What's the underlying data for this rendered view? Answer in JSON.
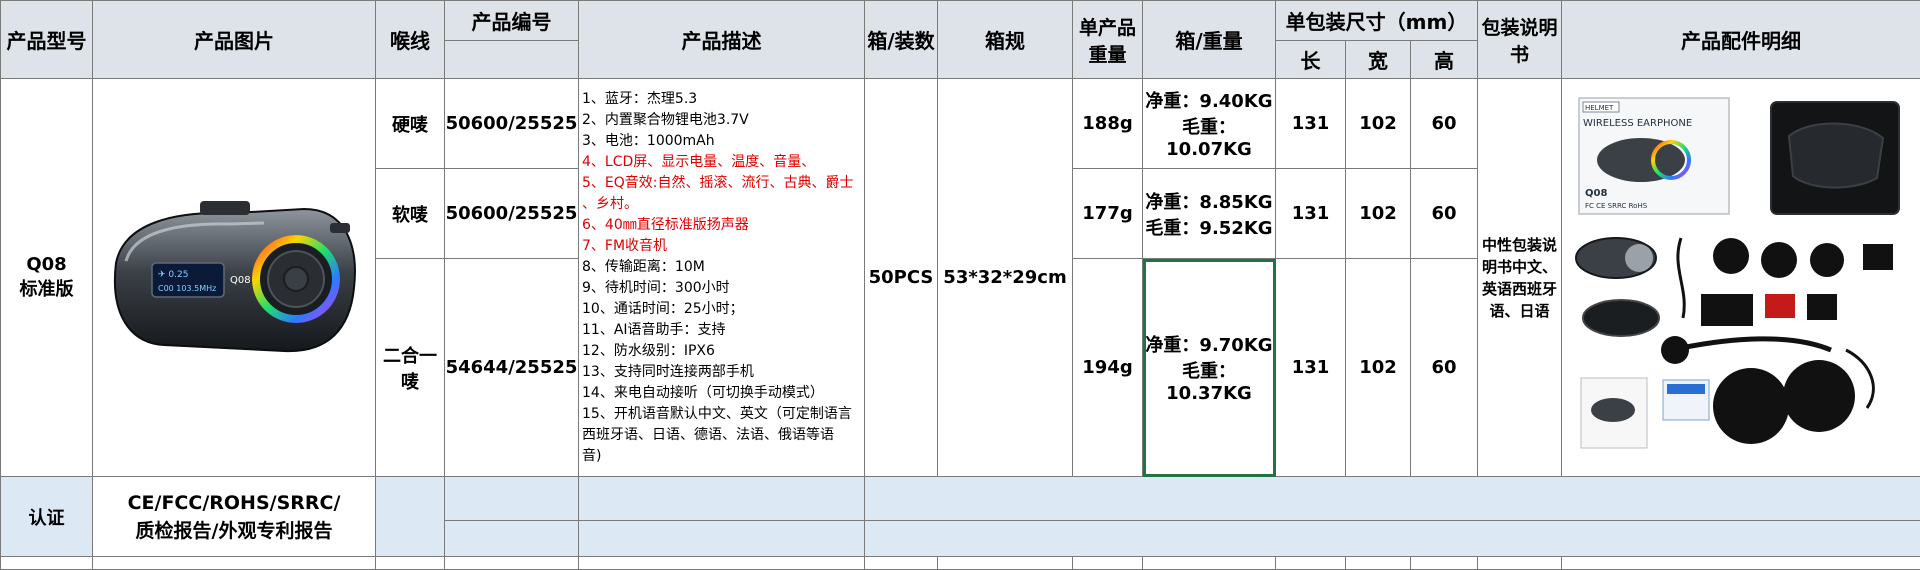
{
  "headers": {
    "model": "产品型号",
    "image": "产品图片",
    "speaker": "喉线",
    "code": "产品编号",
    "desc": "产品描述",
    "pack_qty": "箱/装数",
    "carton": "箱规",
    "unit_weight": "单产品重量",
    "carton_weight": "箱/重量",
    "pack_size": "单包装尺寸（mm）",
    "len": "长",
    "wid": "宽",
    "hgt": "高",
    "manual": "包装说明书",
    "accessories": "产品配件明细"
  },
  "product": {
    "model_line1": "Q08",
    "model_line2": "标准版",
    "screen_line1": "✈ 0.25",
    "screen_line2": "C00  103.5MHz",
    "screen_brand": "Q08",
    "pack_qty": "50PCS",
    "carton": "53*32*29cm",
    "manual": "中性包装说明书中文、英语西班牙语、日语"
  },
  "variants": [
    {
      "speaker": "硬唛",
      "code": "50600/25525",
      "unit_weight": "188g",
      "net": "净重：9.40KG",
      "gross": "毛重：10.07KG",
      "len": "131",
      "wid": "102",
      "hgt": "60"
    },
    {
      "speaker": "软唛",
      "code": "50600/25525",
      "unit_weight": "177g",
      "net": "净重：8.85KG",
      "gross": "毛重：9.52KG",
      "len": "131",
      "wid": "102",
      "hgt": "60"
    },
    {
      "speaker": "二合一唛",
      "code": "54644/25525",
      "unit_weight": "194g",
      "net": "净重：9.70KG",
      "gross": "毛重：10.37KG",
      "len": "131",
      "wid": "102",
      "hgt": "60"
    }
  ],
  "description": [
    {
      "text": "1、蓝牙：杰理5.3",
      "red": false
    },
    {
      "text": "2、内置聚合物锂电池3.7V",
      "red": false
    },
    {
      "text": "3、电池：1000mAh",
      "red": false
    },
    {
      "text": "4、LCD屏、显示电量、温度、音量、",
      "red": true
    },
    {
      "text": "5、EQ音效:自然、摇滚、流行、古典、爵士",
      "red": true
    },
    {
      "text": "、乡村。",
      "red": true
    },
    {
      "text": "6、40㎜直径标准版扬声器",
      "red": true
    },
    {
      "text": "7、FM收音机",
      "red": true
    },
    {
      "text": "8、传输距离：10M",
      "red": false
    },
    {
      "text": "9、待机时间：300小时",
      "red": false
    },
    {
      "text": "10、通话时间：25小时；",
      "red": false
    },
    {
      "text": "11、AI语音助手：支持",
      "red": false
    },
    {
      "text": "12、防水级别：IPX6",
      "red": false
    },
    {
      "text": "13、支持同时连接两部手机",
      "red": false
    },
    {
      "text": "14、来电自动接听（可切换手动模式）",
      "red": false
    },
    {
      "text": "15、开机语音默认中文、英文（可定制语言",
      "red": false
    },
    {
      "text": "西班牙语、日语、德语、法语、俄语等语",
      "red": false
    },
    {
      "text": "音)",
      "red": false
    }
  ],
  "certification": {
    "label": "认证",
    "line1": "CE/FCC/ROHS/SRRC/",
    "line2": "质检报告/外观专利报告"
  },
  "accessory_box": {
    "brand": "HELMET",
    "title": "WIRELESS EARPHONE",
    "model": "Q08",
    "marks": "FC CE SRRC RoHS"
  },
  "colors": {
    "header_bg": "#dde3e9",
    "cert_bg": "#dce9f5",
    "red_text": "#e00000",
    "selection": "#217346"
  }
}
